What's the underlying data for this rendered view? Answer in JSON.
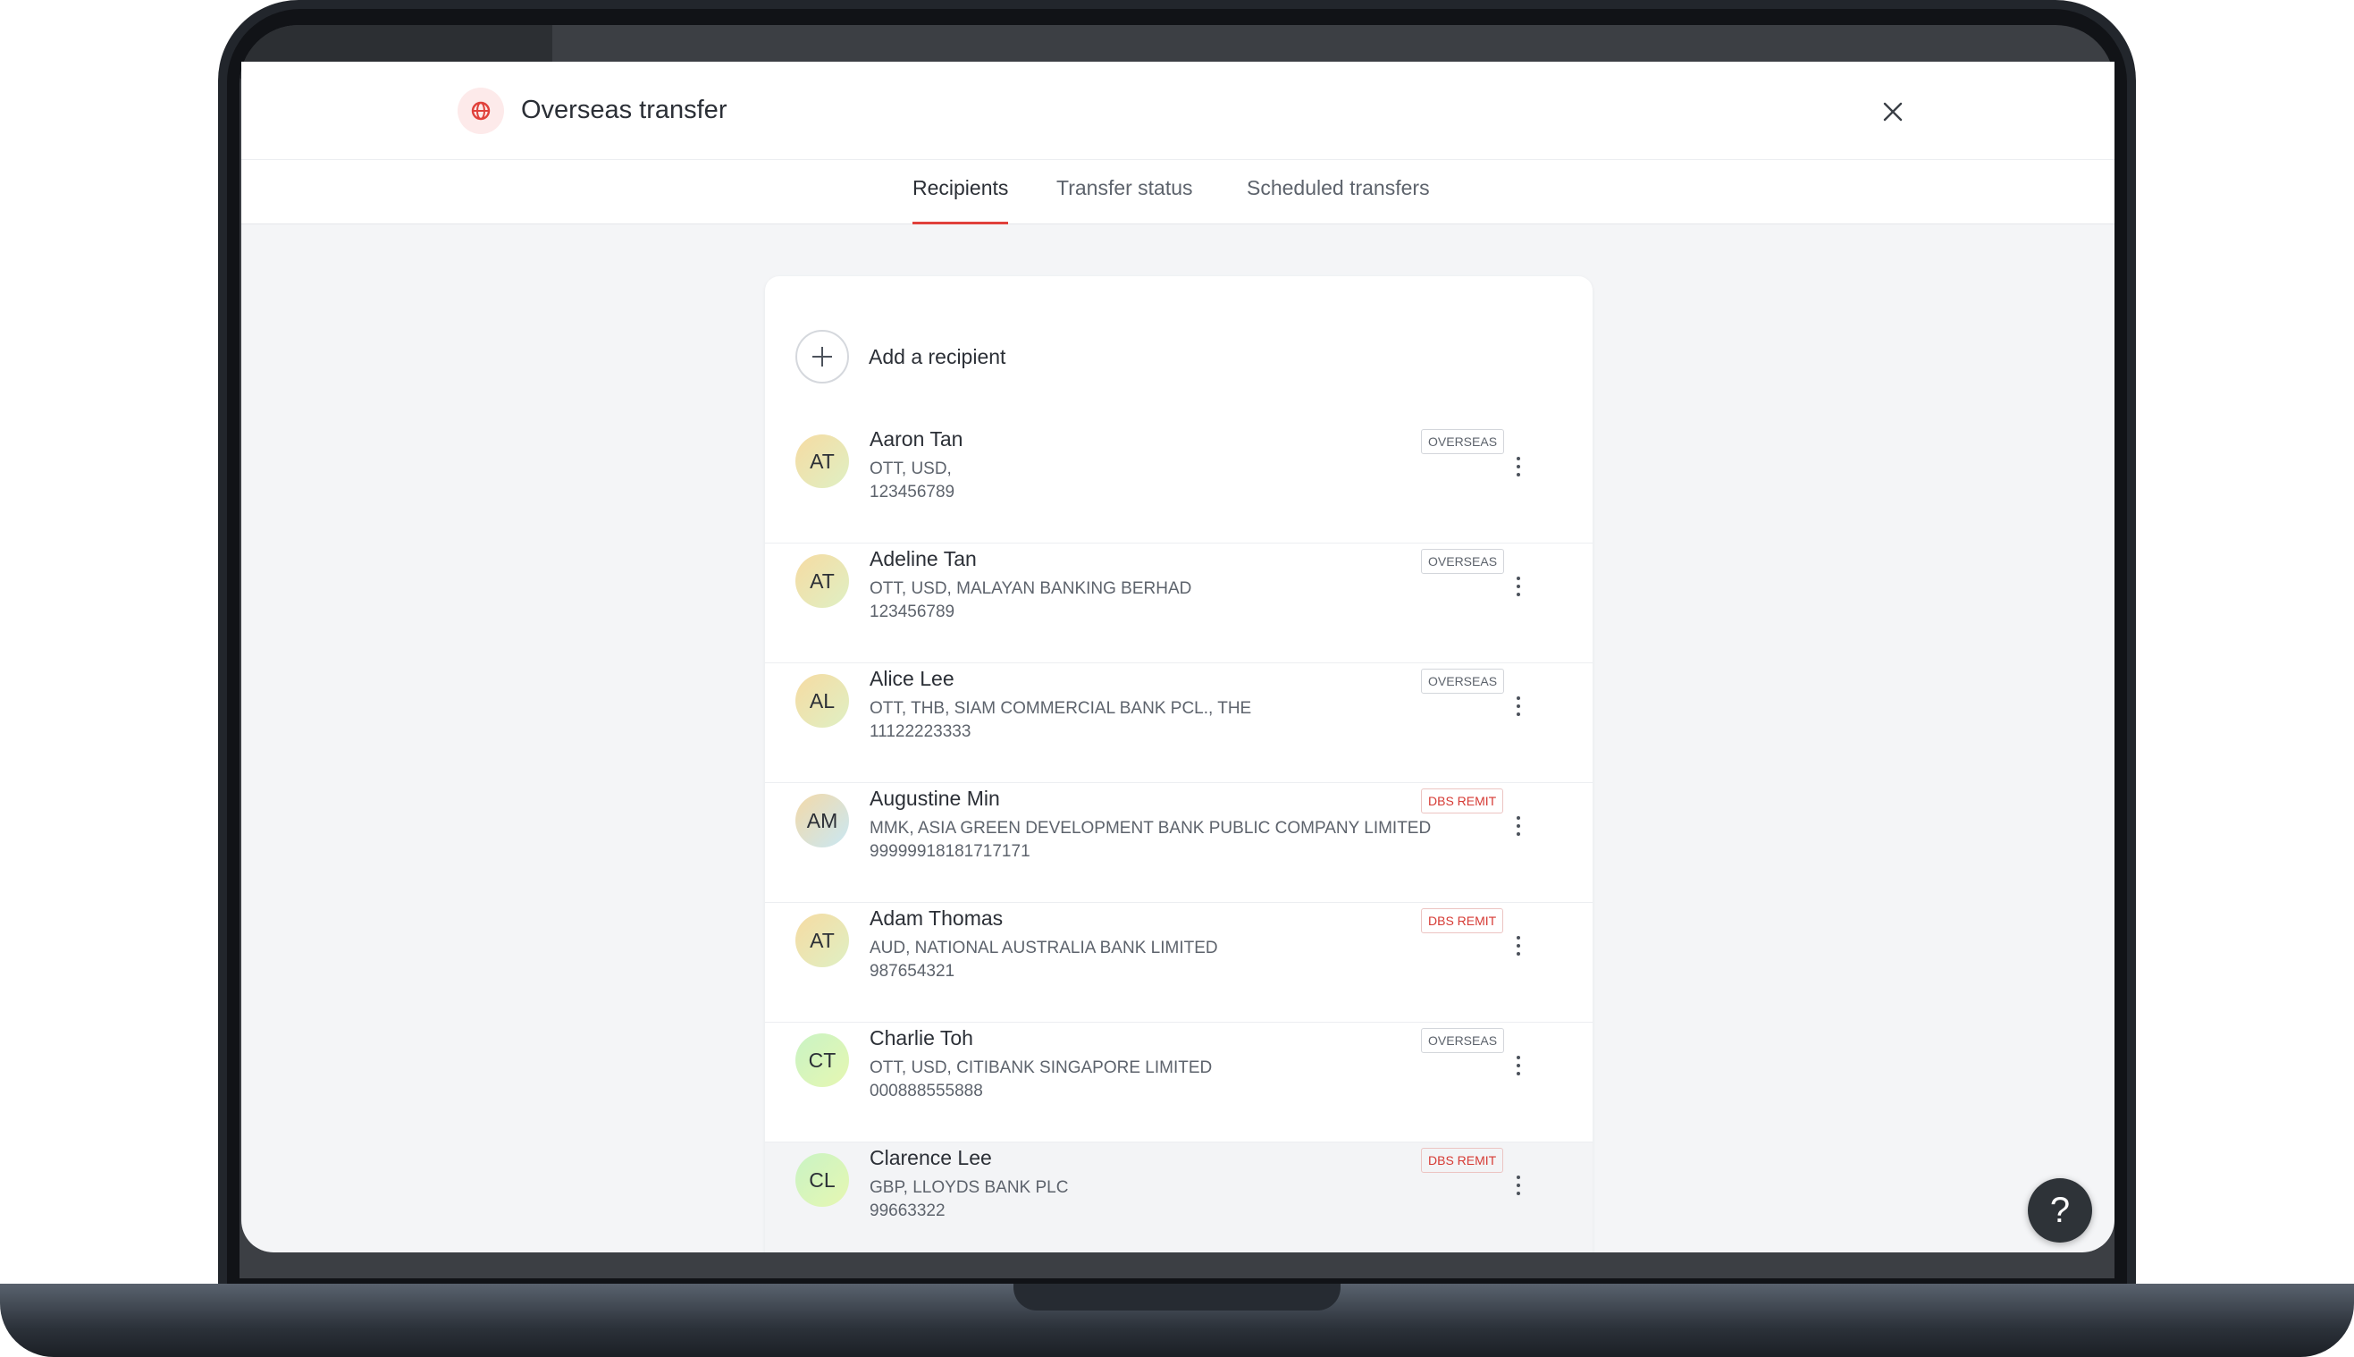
{
  "header": {
    "title": "Overseas transfer",
    "brand_icon": "globe-icon",
    "close_icon": "close-icon"
  },
  "tabs": [
    {
      "label": "Recipients",
      "active": true
    },
    {
      "label": "Transfer status",
      "active": false
    },
    {
      "label": "Scheduled transfers",
      "active": false
    }
  ],
  "add_recipient": {
    "label": "Add a recipient",
    "icon": "plus-icon"
  },
  "recipients": [
    {
      "initials": "AT",
      "name": "Aaron Tan",
      "line1": "OTT, USD,",
      "line2": "123456789",
      "badge": "OVERSEAS"
    },
    {
      "initials": "AT",
      "name": "Adeline Tan",
      "line1": "OTT, USD, MALAYAN BANKING BERHAD",
      "line2": "123456789",
      "badge": "OVERSEAS"
    },
    {
      "initials": "AL",
      "name": "Alice Lee",
      "line1": "OTT, THB, SIAM COMMERCIAL BANK PCL., THE",
      "line2": "11122223333",
      "badge": "OVERSEAS"
    },
    {
      "initials": "AM",
      "name": "Augustine Min",
      "line1": "MMK, ASIA GREEN DEVELOPMENT BANK PUBLIC COMPANY LIMITED",
      "line2": "99999918181717171",
      "badge": "DBS REMIT"
    },
    {
      "initials": "AT",
      "name": "Adam Thomas",
      "line1": "AUD, NATIONAL AUSTRALIA BANK LIMITED",
      "line2": "987654321",
      "badge": "DBS REMIT"
    },
    {
      "initials": "CT",
      "name": "Charlie Toh",
      "line1": "OTT, USD, CITIBANK SINGAPORE LIMITED",
      "line2": "000888555888",
      "badge": "OVERSEAS"
    },
    {
      "initials": "CL",
      "name": "Clarence Lee",
      "line1": "GBP, LLOYDS BANK PLC",
      "line2": "99663322",
      "badge": "DBS REMIT"
    }
  ],
  "help": {
    "label": "?"
  },
  "colors": {
    "accent": "#e0413b",
    "remit_badge": "#d63a34",
    "text_primary": "#2b2f36",
    "text_secondary": "#5d636c",
    "screen_bg": "#f4f5f7"
  }
}
